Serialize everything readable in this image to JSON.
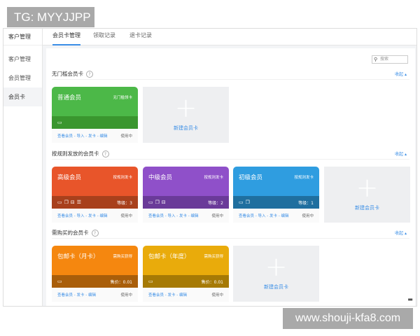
{
  "watermarks": {
    "top": "TG: MYYJJPP",
    "bottom": "www.shouji-kfa8.com"
  },
  "sidebar": {
    "header": "客户管理",
    "items": [
      {
        "label": "客户管理"
      },
      {
        "label": "会员管理"
      },
      {
        "label": "会员卡",
        "active": true
      }
    ]
  },
  "tabs": [
    {
      "label": "会员卡管理",
      "active": true
    },
    {
      "label": "领取记录"
    },
    {
      "label": "退卡记录"
    }
  ],
  "search": {
    "placeholder": "搜索"
  },
  "collapse_label": "收起",
  "new_card_label": "新建会员卡",
  "sections": [
    {
      "title": "无门槛会员卡",
      "cards": [
        {
          "name": "普通会员",
          "type": "无门槛领卡",
          "color": "#4cb848",
          "band": "#3a962f",
          "icons": [
            "calendar"
          ],
          "info": "",
          "links": "查看会员 - 导入 - 发卡 - 编辑",
          "status": "使用中"
        }
      ]
    },
    {
      "title": "按规则发放的会员卡",
      "cards": [
        {
          "name": "高级会员",
          "type": "按规则发卡",
          "color": "#e8552a",
          "band": "#a8401c",
          "icons": [
            "calendar",
            "copy",
            "gift",
            "list"
          ],
          "info": "等级：3",
          "links": "查看会员 - 导入 - 发卡 - 编辑",
          "status": "使用中"
        },
        {
          "name": "中级会员",
          "type": "按规则发卡",
          "color": "#8f50c9",
          "band": "#6a3a99",
          "icons": [
            "calendar",
            "copy",
            "gift"
          ],
          "info": "等级：2",
          "links": "查看会员 - 导入 - 发卡 - 编辑",
          "status": "使用中"
        },
        {
          "name": "初级会员",
          "type": "按规则发卡",
          "color": "#2f9de0",
          "band": "#1f6f9f",
          "icons": [
            "calendar",
            "copy"
          ],
          "info": "等级：1",
          "links": "查看会员 - 导入 - 发卡 - 编辑",
          "status": "使用中"
        }
      ]
    },
    {
      "title": "需购买的会员卡",
      "cards": [
        {
          "name": "包邮卡（月卡）",
          "type": "需购买获得",
          "color": "#f5870f",
          "band": "#a95e0a",
          "icons": [
            "calendar"
          ],
          "info": "售价：0.01",
          "links": "查看会员 - 发卡 - 编辑",
          "status": "使用中"
        },
        {
          "name": "包邮卡（年度）",
          "type": "需购买获得",
          "color": "#e9ab0b",
          "band": "#a67a05",
          "icons": [
            "calendar"
          ],
          "info": "售价：0.01",
          "links": "查看会员 - 发卡 - 编辑",
          "status": "使用中"
        }
      ]
    }
  ]
}
